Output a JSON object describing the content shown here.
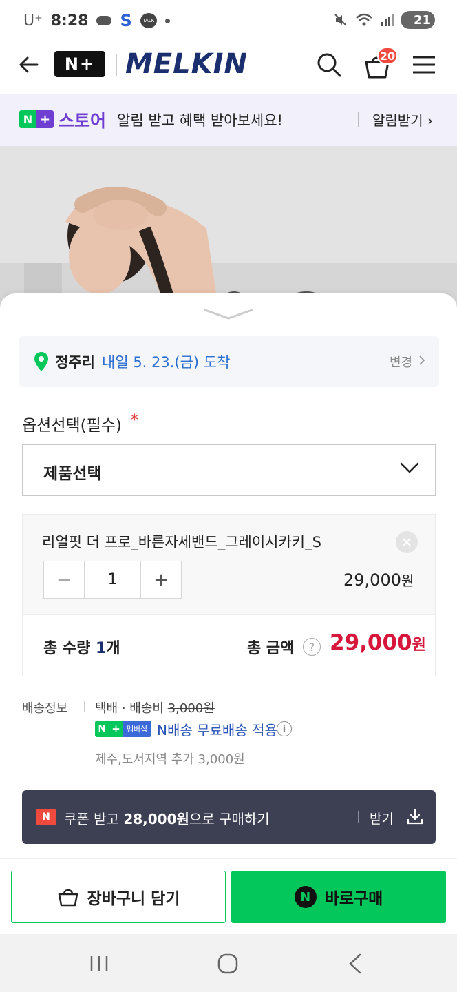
{
  "status_bar": {
    "carrier": "U⁺",
    "time": "8:28",
    "s_icon": "S",
    "talk_icon": "TALK",
    "battery": "21"
  },
  "header": {
    "nplus_logo": "N+",
    "brand": "MELKIN",
    "cart_count": "20"
  },
  "promo": {
    "badge_n": "N",
    "badge_plus": "+",
    "store": "스토어",
    "text": "알림 받고 혜택 받아보세요!",
    "cta": "알림받기"
  },
  "delivery": {
    "place": "정주리",
    "date": "내일 5. 23.(금) 도착",
    "change": "변경"
  },
  "option": {
    "label": "옵션선택(필수)",
    "required": "*",
    "select_label": "제품선택"
  },
  "selected_item": {
    "name": "리얼핏 더 프로_바른자세밴드_그레이시카키_S",
    "minus": "−",
    "qty": "1",
    "plus": "+",
    "price": "29,000",
    "price_unit": "원"
  },
  "total": {
    "qty_label_prefix": "총 수량 ",
    "qty_num": "1",
    "qty_suffix": "개",
    "amount_label": "총 금액",
    "help": "?",
    "amount": "29,000",
    "amount_unit": "원"
  },
  "shipping": {
    "label": "배송정보",
    "method": "택배 · 배송비 ",
    "fee": "3,000원",
    "member_n": "N",
    "member_plus": "+",
    "member_text": "멤버십",
    "free_text": "N배송 무료배송 적용",
    "info": "i",
    "island_fee": "제주,도서지역 추가 3,000원"
  },
  "coupon": {
    "badge": "N",
    "text_prefix": "쿠폰 받고 ",
    "text_amount": "28,000원",
    "text_suffix": "으로 구매하기",
    "cta": "받기"
  },
  "buttons": {
    "cart": "장바구니 담기",
    "buy_icon": "N",
    "buy": "바로구매"
  },
  "colors": {
    "naver_green": "#03c75a",
    "plus_purple": "#6f3fd1",
    "price_red": "#d6163a",
    "brand_navy": "#1b2f6e",
    "coupon_bg": "#3d3f52"
  }
}
